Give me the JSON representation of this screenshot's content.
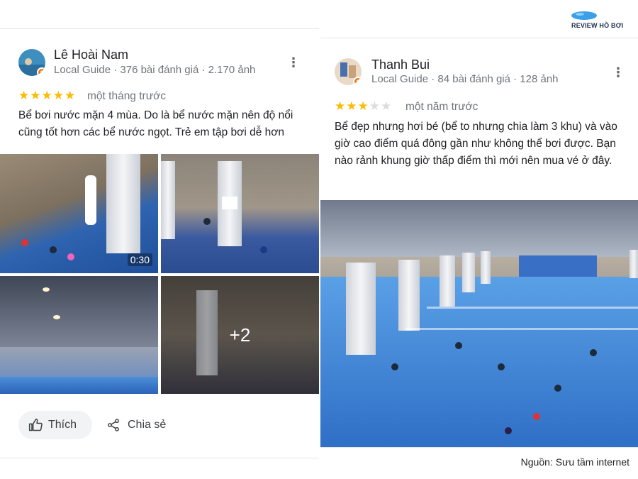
{
  "brand": {
    "logo_text": "REVIEW HỒ BƠI",
    "logo_color": "#3aa0e8"
  },
  "source_note": "Nguồn: Sưu tầm internet",
  "reviews": [
    {
      "author": "Lê Hoài Nam",
      "meta": "Local Guide · 376 bài đánh giá · 2.170 ảnh",
      "rating": 5,
      "time": "một tháng trước",
      "text": "Bể bơi nước mặn 4 mùa. Do là bể nước mặn nên độ nổi cũng tốt hơn các bể nước ngọt. Trẻ em tập bơi dễ hơn",
      "photos": {
        "video_duration": "0:30",
        "more_count": "+2"
      },
      "actions": {
        "like_label": "Thích",
        "share_label": "Chia sẻ"
      }
    },
    {
      "author": "Thanh Bui",
      "meta": "Local Guide · 84 bài đánh giá · 128 ảnh",
      "rating": 3,
      "time": "một năm trước",
      "text": "Bể đẹp nhưng hơi bé (bể to nhưng chia làm 3 khu) và vào giờ cao điểm quá đông gần như không thể bơi được. Bạn nào rảnh khung giờ thấp điểm thì mới nên mua vé ở đây."
    }
  ],
  "colors": {
    "star": "#fbbc04",
    "star_empty": "#dadce0",
    "guide_badge": "#e8710a"
  }
}
